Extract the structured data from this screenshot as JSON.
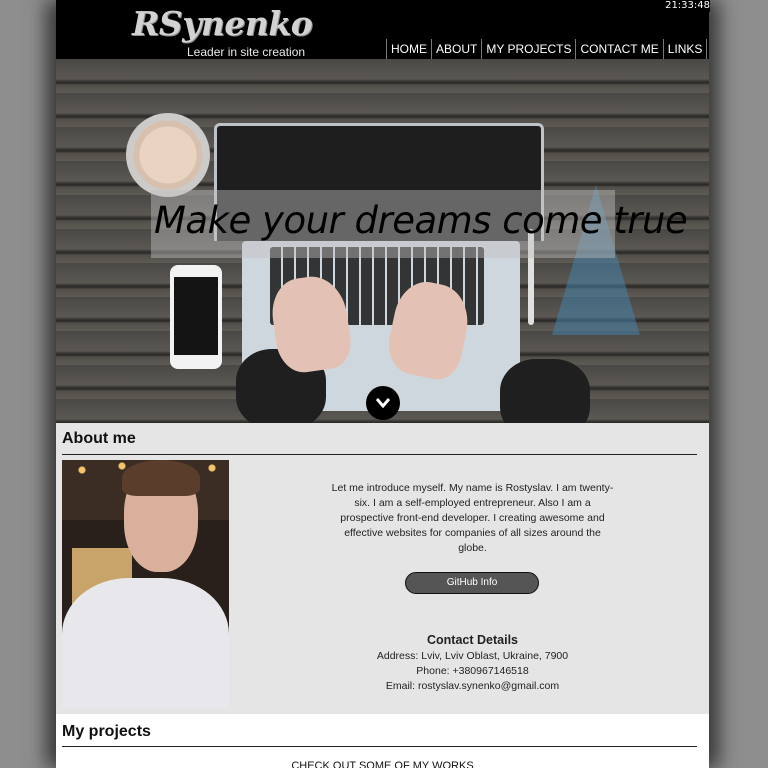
{
  "clock": "21:33:48",
  "header": {
    "logo": "RSynenko",
    "tagline": "Leader in site creation",
    "nav": [
      "HOME",
      "ABOUT",
      "MY PROJECTS",
      "CONTACT ME",
      "LINKS"
    ]
  },
  "hero": {
    "headline": "Make your dreams come true",
    "scroll_icon": "chevron-down-icon"
  },
  "about": {
    "title": "About me",
    "intro": "Let me introduce myself. My name is Rostyslav. I am twenty-six. I am a self-employed entrepreneur. Also I am a prospective front-end developer. I creating awesome and effective websites for companies of all sizes around the globe.",
    "github_button": "GitHub Info",
    "contact": {
      "title": "Contact Details",
      "address": "Address: Lviv, Lviv Oblast, Ukraine, 7900",
      "phone": "Phone: +380967146518",
      "email": "Email: rostyslav.synenko@gmail.com"
    }
  },
  "projects": {
    "title": "My projects",
    "subtitle": "CHECK OUT SOME OF MY WORKS"
  },
  "colors": {
    "header_bg": "#000000",
    "about_bg": "#e5e5e5",
    "button_bg": "#555555",
    "outer_bg": "#8e8e8e"
  }
}
